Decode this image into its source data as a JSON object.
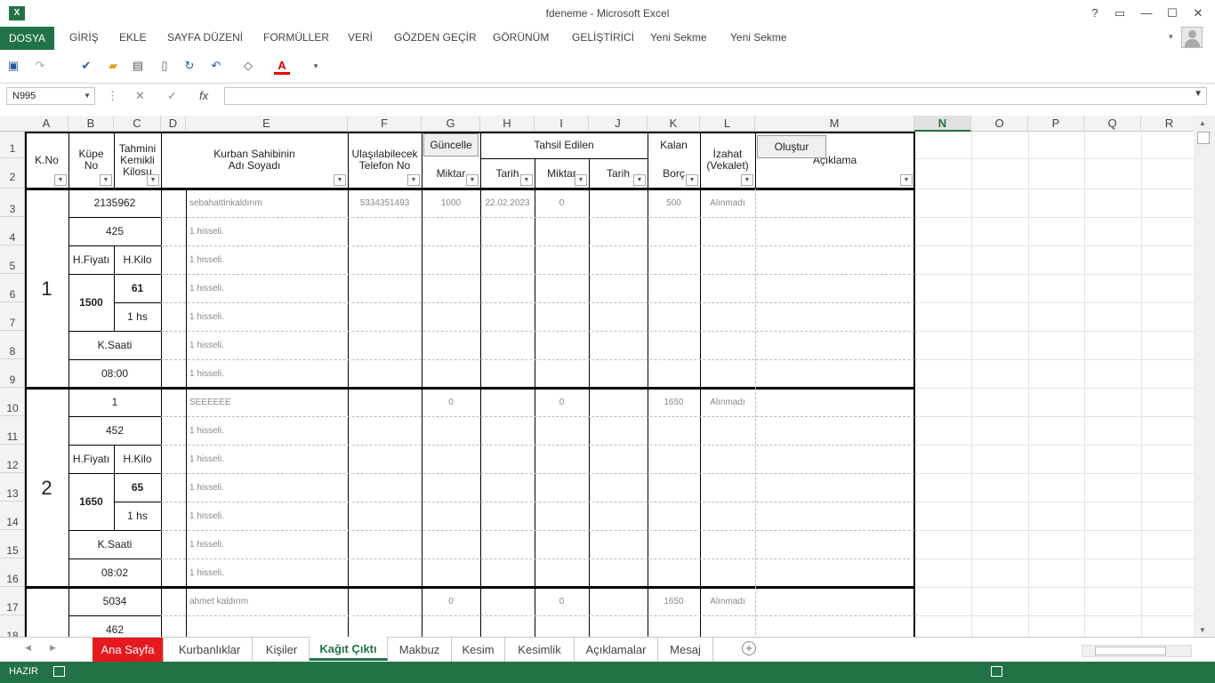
{
  "window": {
    "title": "fdeneme - Microsoft Excel",
    "app_icon": "X",
    "help": "?",
    "restore_ribbon": "▭",
    "minimize": "—",
    "maximize": "☐",
    "close": "✕"
  },
  "ribbon_tabs": [
    "DOSYA",
    "GİRİŞ",
    "EKLE",
    "SAYFA DÜZENİ",
    "FORMÜLLER",
    "VERİ",
    "GÖZDEN GEÇİR",
    "GÖRÜNÜM",
    "GELİŞTİRİCİ",
    "Yeni Sekme",
    "Yeni Sekme"
  ],
  "formula_bar": {
    "name_box": "N995",
    "fx": "fx",
    "cancel": "✕",
    "enter": "✓",
    "formula": ""
  },
  "columns": [
    "A",
    "B",
    "C",
    "D",
    "E",
    "F",
    "G",
    "H",
    "I",
    "J",
    "K",
    "L",
    "M",
    "N",
    "O",
    "P",
    "Q",
    "R"
  ],
  "rows": [
    "1",
    "2",
    "3",
    "4",
    "5",
    "6",
    "7",
    "8",
    "9",
    "10",
    "11",
    "12",
    "13",
    "14",
    "15",
    "16",
    "17",
    "18"
  ],
  "headers": {
    "kno": "K.No",
    "kupe_no": "Küpe\nNo",
    "tahmini": "Tahmini\nKemikli\nKilosu",
    "kurban_sahibi": "Kurban Sahibinin\nAdı Soyadı",
    "telefon": "Ulaşılabilecek\nTelefon No",
    "guncelle_button": "Güncelle",
    "tahsil_edilen": "Tahsil Edilen",
    "miktar1": "Miktar",
    "tarih1": "Tarih",
    "miktar2": "Miktar",
    "tarih2": "Tarih",
    "kalan": "Kalan",
    "borc": "Borç",
    "izahat": "İzahat\n(Vekalet)",
    "olustur_button": "Oluştur",
    "aciklama": "Açıklama"
  },
  "blocks": [
    {
      "kno": "1",
      "kupe": "2135962",
      "kilo_no": "425",
      "hfiyati_label": "H.Fiyatı",
      "hkilo_label": "H.Kilo",
      "hfiyati": "1500",
      "hkilo": "61",
      "hisse": "1 hs",
      "ksaati_label": "K.Saati",
      "ksaati": "08:00",
      "names": [
        "sebahattinkaldırım",
        "1 hisseli.",
        "1 hisseli.",
        "1 hisseli.",
        "1 hisseli.",
        "1 hisseli.",
        "1 hisseli."
      ],
      "telefon": "5334351493",
      "miktar": "1000",
      "tarih": "22.02.2023",
      "miktar2": "0",
      "borc": "500",
      "izahat": "Alınmadı"
    },
    {
      "kno": "2",
      "kupe": "1",
      "kilo_no": "452",
      "hfiyati_label": "H.Fiyatı",
      "hkilo_label": "H.Kilo",
      "hfiyati": "1650",
      "hkilo": "65",
      "hisse": "1 hs",
      "ksaati_label": "K.Saati",
      "ksaati": "08:02",
      "names": [
        "SEEEEEE",
        "1 hisseli.",
        "1 hisseli.",
        "1 hisseli.",
        "1 hisseli.",
        "1 hisseli.",
        "1 hisseli."
      ],
      "telefon": "",
      "miktar": "0",
      "tarih": "",
      "miktar2": "0",
      "borc": "1650",
      "izahat": "Alınmadı"
    },
    {
      "kno": "",
      "kupe": "5034",
      "kilo_no": "462",
      "names": [
        "ahmet kaldırım"
      ],
      "telefon": "",
      "miktar": "0",
      "tarih": "",
      "miktar2": "0",
      "borc": "1650",
      "izahat": "Alınmadı"
    }
  ],
  "sheet_tabs": [
    "Ana Sayfa",
    "Kurbanlıklar",
    "Kişiler",
    "Kağıt Çıktı",
    "Makbuz",
    "Kesim",
    "Kesimlik",
    "Açıklamalar",
    "Mesaj"
  ],
  "active_sheet": "Kağıt Çıktı",
  "status": {
    "mode": "HAZIR"
  },
  "colors": {
    "excel_green": "#217346",
    "ana_sayfa_tab": "#e8191e"
  }
}
